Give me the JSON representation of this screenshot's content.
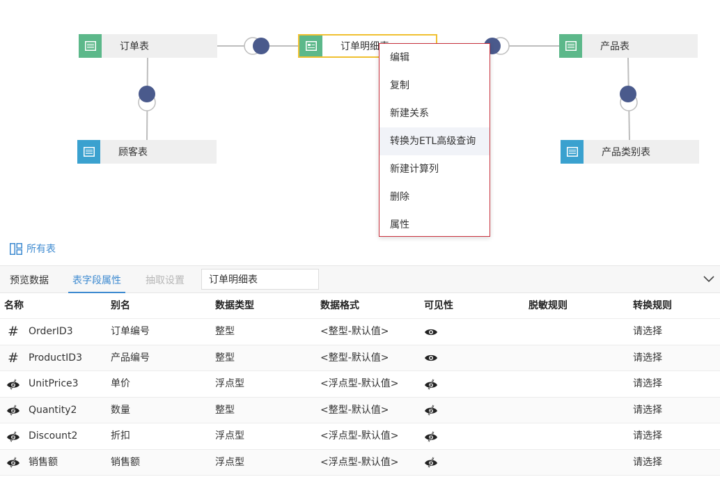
{
  "diagram": {
    "nodes": [
      {
        "id": "orders",
        "label": "订单表",
        "color": "green"
      },
      {
        "id": "order-details",
        "label": "订单明细表",
        "color": "green",
        "selected": true
      },
      {
        "id": "products",
        "label": "产品表",
        "color": "green"
      },
      {
        "id": "customers",
        "label": "顾客表",
        "color": "blue"
      },
      {
        "id": "categories",
        "label": "产品类别表",
        "color": "blue"
      }
    ]
  },
  "context_menu": {
    "items": [
      "编辑",
      "复制",
      "新建关系",
      "转换为ETL高级查询",
      "新建计算列",
      "删除",
      "属性"
    ],
    "hovered_index": 3
  },
  "all_tables_label": "所有表",
  "tabs": {
    "preview": "预览数据",
    "fields": "表字段属性",
    "extract": "抽取设置",
    "active": "fields",
    "table_name_value": "订单明细表"
  },
  "grid": {
    "headers": [
      "名称",
      "别名",
      "数据类型",
      "数据格式",
      "可见性",
      "脱敏规则",
      "转换规则"
    ],
    "rows": [
      {
        "icon": "hash-icon",
        "name": "OrderID3",
        "alias": "订单编号",
        "type": "整型",
        "format": "<整型-默认值>",
        "visibility": "eye-open-icon",
        "mask": "",
        "convert": "请选择"
      },
      {
        "icon": "hash-icon",
        "name": "ProductID3",
        "alias": "产品编号",
        "type": "整型",
        "format": "<整型-默认值>",
        "visibility": "eye-open-icon",
        "mask": "",
        "convert": "请选择"
      },
      {
        "icon": "eye-slash-icon",
        "name": "UnitPrice3",
        "alias": "单价",
        "type": "浮点型",
        "format": "<浮点型-默认值>",
        "visibility": "eye-slash-icon",
        "mask": "",
        "convert": "请选择"
      },
      {
        "icon": "eye-slash-icon",
        "name": "Quantity2",
        "alias": "数量",
        "type": "整型",
        "format": "<整型-默认值>",
        "visibility": "eye-slash-icon",
        "mask": "",
        "convert": "请选择"
      },
      {
        "icon": "eye-slash-icon",
        "name": "Discount2",
        "alias": "折扣",
        "type": "浮点型",
        "format": "<浮点型-默认值>",
        "visibility": "eye-slash-icon",
        "mask": "",
        "convert": "请选择"
      },
      {
        "icon": "eye-slash-icon",
        "name": "销售额",
        "alias": "销售额",
        "type": "浮点型",
        "format": "<浮点型-默认值>",
        "visibility": "eye-slash-icon",
        "mask": "",
        "convert": "请选择"
      }
    ]
  },
  "colors": {
    "accent": "#3d8ad0",
    "node_green": "#5cb88a",
    "node_blue": "#3aa1cf",
    "join_dot": "#4a5a8c",
    "selected_border": "#f0c030",
    "menu_border": "#c8303c"
  }
}
